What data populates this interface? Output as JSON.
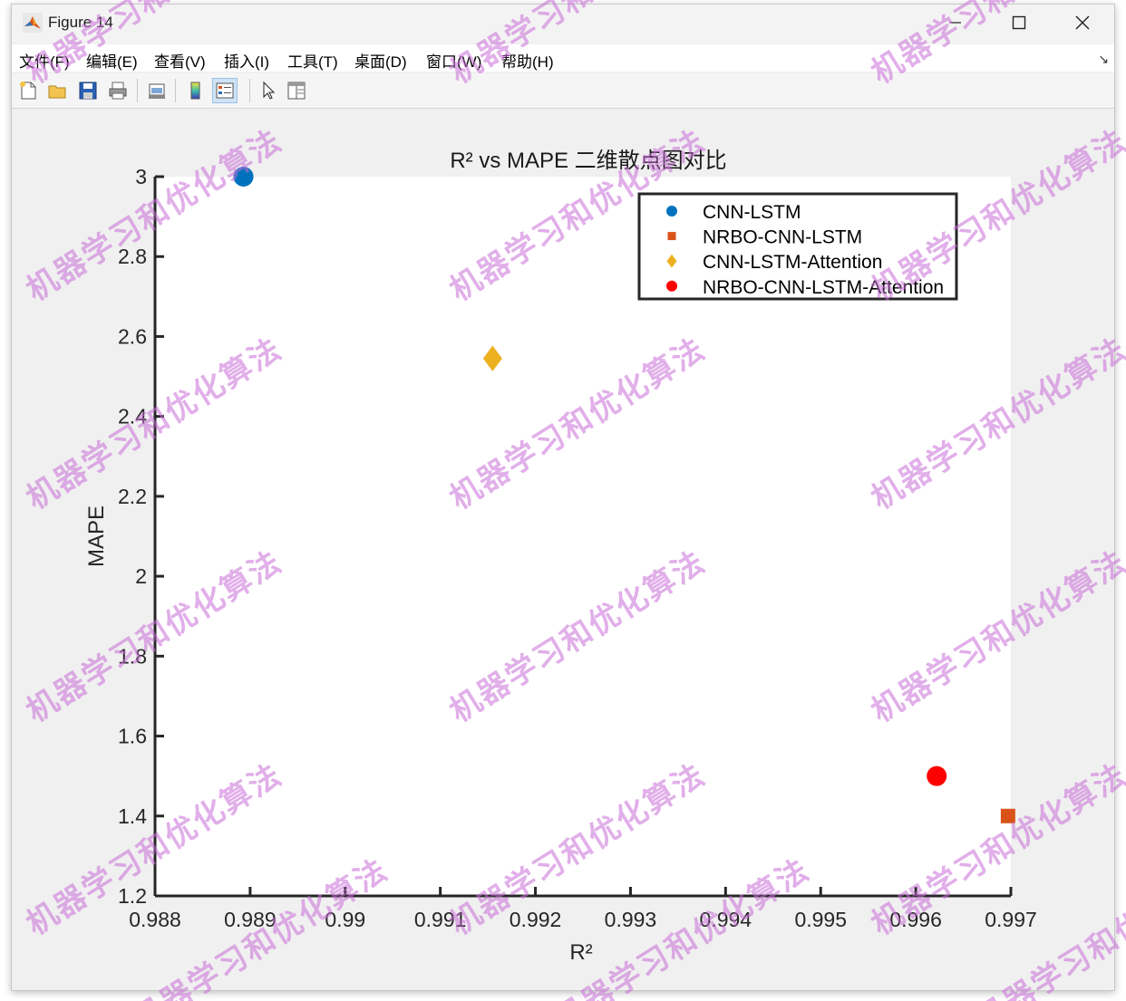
{
  "window": {
    "title": "Figure 14"
  },
  "menu": [
    {
      "label": "文件(F)"
    },
    {
      "label": "编辑(E)"
    },
    {
      "label": "查看(V)"
    },
    {
      "label": "插入(I)"
    },
    {
      "label": "工具(T)"
    },
    {
      "label": "桌面(D)"
    },
    {
      "label": "窗口(W)"
    },
    {
      "label": "帮助(H)"
    }
  ],
  "toolbar": {
    "icons": [
      "new-figure-icon",
      "open-icon",
      "save-icon",
      "print-icon",
      "print-preview-icon",
      "colorbar-icon",
      "legend-icon",
      "pointer-icon",
      "property-editor-icon"
    ],
    "active": "legend-icon"
  },
  "watermark_text": "机器学习和优化算法",
  "chart_data": {
    "type": "scatter",
    "title": "R² vs MAPE 二维散点图对比",
    "xlabel": "R²",
    "ylabel": "MAPE",
    "xlim": [
      0.988,
      0.997
    ],
    "ylim": [
      1.2,
      3.0
    ],
    "xticks": [
      "0.988",
      "0.989",
      "0.99",
      "0.991",
      "0.992",
      "0.993",
      "0.994",
      "0.995",
      "0.996",
      "0.997"
    ],
    "yticks": [
      "1.2",
      "1.4",
      "1.6",
      "1.8",
      "2",
      "2.2",
      "2.4",
      "2.6",
      "2.8",
      "3"
    ],
    "grid": false,
    "legend_position": "top-right",
    "series": [
      {
        "name": "CNN-LSTM",
        "marker": "circle",
        "color": "#0072BD",
        "x": [
          0.98893
        ],
        "y": [
          3.0
        ]
      },
      {
        "name": "NRBO-CNN-LSTM",
        "marker": "square",
        "color": "#D95319",
        "x": [
          0.99697
        ],
        "y": [
          1.4
        ]
      },
      {
        "name": "CNN-LSTM-Attention",
        "marker": "diamond",
        "color": "#EDB120",
        "x": [
          0.99155
        ],
        "y": [
          2.545
        ]
      },
      {
        "name": "NRBO-CNN-LSTM-Attention",
        "marker": "circle",
        "color": "#FF0000",
        "x": [
          0.99622
        ],
        "y": [
          1.5
        ]
      }
    ]
  }
}
